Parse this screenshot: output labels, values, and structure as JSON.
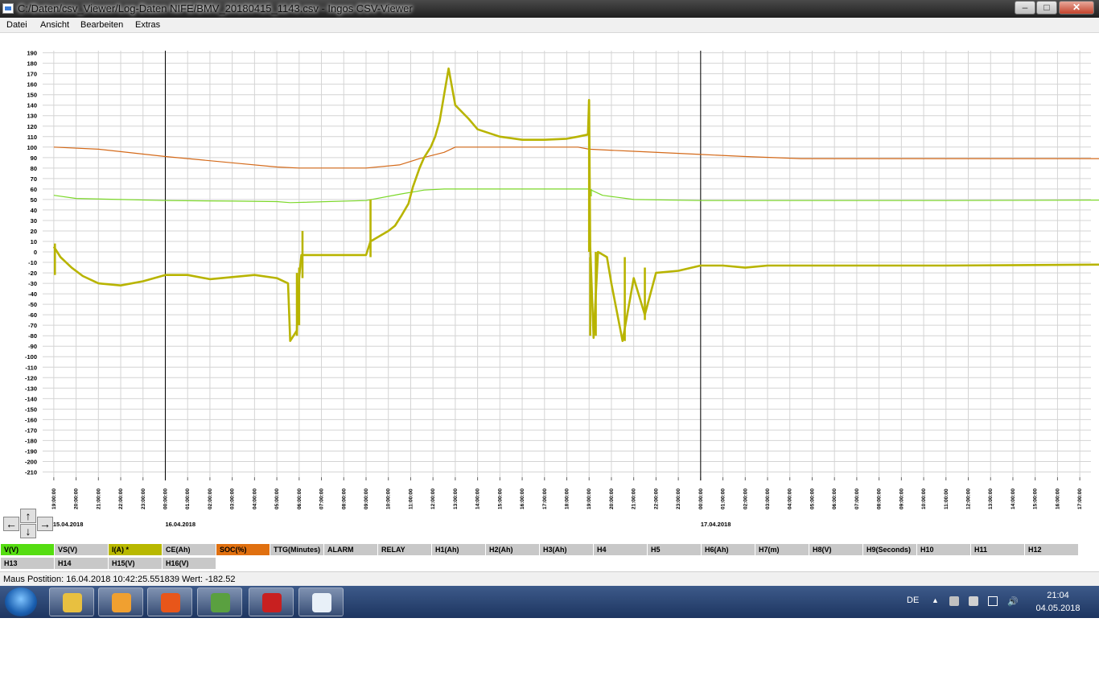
{
  "window": {
    "title": "C:/Daten/csv_Viewer/Log-Daten NIFE/BMV_20180415_1143.csv - Ingos CSV-Viewer",
    "min": "–",
    "max": "□",
    "close": "✕"
  },
  "menu": [
    "Datei",
    "Ansicht",
    "Bearbeiten",
    "Extras"
  ],
  "nav": {
    "left": "←",
    "up": "↑",
    "down": "↓",
    "right": "→"
  },
  "legend": [
    {
      "label": "V(V)",
      "color": "#55dd11"
    },
    {
      "label": "VS(V)",
      "color": "#c8c8c8"
    },
    {
      "label": "I(A) *",
      "color": "#b8b800"
    },
    {
      "label": "CE(Ah)",
      "color": "#c8c8c8"
    },
    {
      "label": "SOC(%)",
      "color": "#e07010"
    },
    {
      "label": "TTG(Minutes)",
      "color": "#c8c8c8"
    },
    {
      "label": "ALARM",
      "color": "#c8c8c8"
    },
    {
      "label": "RELAY",
      "color": "#c8c8c8"
    },
    {
      "label": "H1(Ah)",
      "color": "#c8c8c8"
    },
    {
      "label": "H2(Ah)",
      "color": "#c8c8c8"
    },
    {
      "label": "H3(Ah)",
      "color": "#c8c8c8"
    },
    {
      "label": "H4",
      "color": "#c8c8c8"
    },
    {
      "label": "H5",
      "color": "#c8c8c8"
    },
    {
      "label": "H6(Ah)",
      "color": "#c8c8c8"
    },
    {
      "label": "H7(m)",
      "color": "#c8c8c8"
    },
    {
      "label": "H8(V)",
      "color": "#c8c8c8"
    },
    {
      "label": "H9(Seconds)",
      "color": "#c8c8c8"
    },
    {
      "label": "H10",
      "color": "#c8c8c8"
    },
    {
      "label": "H11",
      "color": "#c8c8c8"
    },
    {
      "label": "H12",
      "color": "#c8c8c8"
    },
    {
      "label": "H13",
      "color": "#c8c8c8"
    },
    {
      "label": "H14",
      "color": "#c8c8c8"
    },
    {
      "label": "H15(V)",
      "color": "#c8c8c8"
    },
    {
      "label": "H16(V)",
      "color": "#c8c8c8"
    }
  ],
  "status": {
    "text": "Maus Postition: 16.04.2018 10:42:25.551839 Wert: -182.52"
  },
  "taskbar": {
    "apps": [
      {
        "name": "explorer",
        "color": "#e8c040"
      },
      {
        "name": "outlook",
        "color": "#f0a030"
      },
      {
        "name": "firefox",
        "color": "#e8561a"
      },
      {
        "name": "network-app",
        "color": "#5aa040"
      },
      {
        "name": "pdf-reader",
        "color": "#c82020"
      },
      {
        "name": "csv-viewer",
        "color": "#e8f0f8"
      }
    ],
    "lang": "DE",
    "time": "21:04",
    "date": "04.05.2018"
  },
  "chart_data": {
    "type": "line",
    "ylim": [
      -215,
      192
    ],
    "yticks": [
      190,
      180,
      170,
      160,
      150,
      140,
      130,
      120,
      110,
      100,
      90,
      80,
      70,
      60,
      50,
      40,
      30,
      20,
      10,
      0,
      -10,
      -20,
      -30,
      -40,
      -50,
      -60,
      -70,
      -80,
      -90,
      -100,
      -110,
      -120,
      -130,
      -140,
      -150,
      -160,
      -170,
      -180,
      -190,
      -200,
      -210
    ],
    "x_start_hour": 19,
    "x_hours": 47,
    "xtick_labels": [
      "19:00:00",
      "20:00:00",
      "21:00:00",
      "22:00:00",
      "23:00:00",
      "00:00:00",
      "01:00:00",
      "02:00:00",
      "03:00:00",
      "04:00:00",
      "05:00:00",
      "06:00:00",
      "07:00:00",
      "08:00:00",
      "09:00:00",
      "10:00:00",
      "11:00:00",
      "12:00:00",
      "13:00:00",
      "14:00:00",
      "15:00:00",
      "16:00:00",
      "17:00:00",
      "18:00:00",
      "19:00:00",
      "20:00:00",
      "21:00:00",
      "22:00:00",
      "23:00:00",
      "00:00:00",
      "01:00:00",
      "02:00:00",
      "03:00:00",
      "04:00:00",
      "05:00:00",
      "06:00:00",
      "07:00:00",
      "08:00:00",
      "09:00:00",
      "10:00:00",
      "11:00:00",
      "12:00:00",
      "13:00:00",
      "14:00:00",
      "15:00:00",
      "16:00:00",
      "17:00:00"
    ],
    "day_labels": [
      {
        "hour": 0,
        "label": "15.04.2018"
      },
      {
        "hour": 5,
        "label": "16.04.2018"
      },
      {
        "hour": 29,
        "label": "17.04.2018"
      }
    ],
    "day_lines_hours": [
      5,
      29
    ],
    "series": [
      {
        "name": "SOC(%)",
        "color": "#d46a1a",
        "width": 1.2,
        "hours": [
          0,
          2,
          5,
          8,
          10,
          11,
          14,
          15.5,
          16.4,
          17.5,
          18,
          23.5,
          24,
          26,
          29,
          31,
          33.5,
          47.5
        ],
        "values": [
          100,
          98,
          91,
          85,
          81,
          80,
          80,
          83,
          89,
          95,
          100,
          100,
          98,
          96,
          93,
          91,
          89,
          89
        ]
      },
      {
        "name": "V(V)",
        "color": "#7cd82a",
        "width": 1.2,
        "hours": [
          0,
          1,
          3,
          5,
          8,
          10,
          10.6,
          14,
          15.5,
          16.6,
          17.5,
          18,
          23.5,
          24,
          24.6,
          26,
          29,
          33,
          40,
          47.5
        ],
        "values": [
          54,
          51,
          50,
          49,
          48.5,
          48,
          47,
          49,
          55,
          59,
          60,
          60,
          60,
          60,
          54,
          50,
          49,
          49,
          49,
          49.5
        ],
        "spikes": [
          {
            "hour": 24.1,
            "from": 60,
            "to": 53
          }
        ]
      },
      {
        "name": "I(A) *",
        "color": "#b8b400",
        "width": 2.6,
        "hours": [
          0,
          0.3,
          0.8,
          1.3,
          2,
          3,
          4,
          5,
          6,
          7,
          8,
          9,
          10,
          10.5,
          10.6,
          10.9,
          11,
          11.1,
          11.2,
          13,
          14,
          14.2,
          15,
          15.3,
          15.6,
          15.9,
          16.1,
          16.4,
          16.6,
          16.9,
          17.1,
          17.3,
          17.5,
          17.7,
          18,
          18.6,
          19,
          20,
          21,
          22,
          23,
          23.5,
          23.95,
          24,
          24.05,
          24.2,
          24.4,
          24.8,
          25,
          25.5,
          26,
          26.5,
          27,
          28,
          29,
          30,
          31,
          32,
          33,
          33.5,
          35,
          40,
          47.5
        ],
        "values": [
          5,
          -5,
          -15,
          -23,
          -30,
          -32,
          -28,
          -22,
          -22,
          -26,
          -24,
          -22,
          -25,
          -30,
          -85,
          -75,
          -25,
          -3,
          -3,
          -3,
          -3,
          10,
          20,
          25,
          35,
          46,
          62,
          80,
          90,
          100,
          110,
          125,
          150,
          175,
          140,
          127,
          117,
          110,
          107,
          107,
          108,
          110,
          112,
          145,
          5,
          -82,
          0,
          -5,
          -30,
          -85,
          -25,
          -60,
          -20,
          -18,
          -13,
          -13,
          -15,
          -13,
          -13,
          -13,
          -13,
          -13,
          -12
        ],
        "spikes": [
          {
            "hour": 0.05,
            "from": 8,
            "to": -22
          },
          {
            "hour": 10.9,
            "from": -20,
            "to": -80
          },
          {
            "hour": 11.0,
            "from": -15,
            "to": -70
          },
          {
            "hour": 11.15,
            "from": -25,
            "to": 20
          },
          {
            "hour": 14.2,
            "from": -5,
            "to": 50
          },
          {
            "hour": 24.0,
            "from": 145,
            "to": 0
          },
          {
            "hour": 24.05,
            "from": -5,
            "to": -80
          },
          {
            "hour": 24.3,
            "from": 0,
            "to": -80
          },
          {
            "hour": 25.6,
            "from": -5,
            "to": -85
          },
          {
            "hour": 26.5,
            "from": -15,
            "to": -65
          }
        ]
      }
    ]
  }
}
